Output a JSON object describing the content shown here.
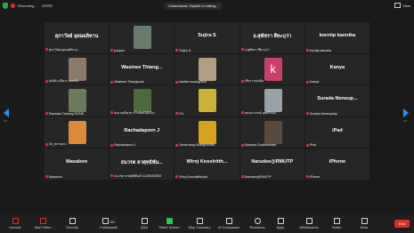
{
  "topbar": {
    "recording": "Recording...",
    "talking": "Chatchawan Silpakit is talking...",
    "view": "View"
  },
  "nav": {
    "left_page": "1/7",
    "right_page": "1/7"
  },
  "participants": [
    {
      "name": "สุภาวัลย์ อุดมผลิทาน",
      "label": "สุภาวัลย์ อุดมผลิทาน",
      "photo": false
    },
    {
      "name": "",
      "label": "jumpen",
      "photo": true,
      "photo_color": "#6a7c6f"
    },
    {
      "name": "Sujira S",
      "label": "Sujira S",
      "photo": false
    },
    {
      "name": "อ.สุพัชรา สี่ทะบุว่า",
      "label": "อ.สุพัชรา สี่ทะบุว่า",
      "photo": false
    },
    {
      "name": "korntip kannika",
      "label": "korntip kannika",
      "photo": false
    },
    {
      "name": "",
      "label": "A048 เปรียวา สมหวัง",
      "photo": true,
      "photo_color": "#8a7a6a"
    },
    {
      "name": "Wasinee  Thiang...",
      "label": "Wasinee Thiangsook",
      "photo": false
    },
    {
      "name": "",
      "label": "kanitar muangchoo",
      "photo": true,
      "photo_color": "#b0a080"
    },
    {
      "name": "",
      "label": "เกียรา ทองคิม",
      "photo": true,
      "photo_color": "#c9406a",
      "photo_letter": "k"
    },
    {
      "name": "Kanya",
      "label": "Kanya",
      "photo": false
    },
    {
      "name": "",
      "label": "Pancake Training RONE",
      "photo": true,
      "photo_color": "#6b7a5a"
    },
    {
      "name": "",
      "label": "พ.ต.กฤษิต ศาวโนรัตน์นิธีเรื่อง",
      "photo": true,
      "photo_color": "#4f6a3a"
    },
    {
      "name": "",
      "label": "Foi",
      "photo": true,
      "photo_color": "#c8b23a"
    },
    {
      "name": "",
      "label": "ลนนภาภรณ์ ลุยศรีลอน",
      "photo": true,
      "photo_color": "#9aa0a8"
    },
    {
      "name": "Surada  Nonsup...",
      "label": "Surada  Nonsuphap",
      "photo": false
    },
    {
      "name": "",
      "label": "03_ทรายเกว",
      "photo": true,
      "photo_color": "#d98a3a"
    },
    {
      "name": "Rachadaporn J",
      "label": "Rachadaporn J",
      "photo": false
    },
    {
      "name": "",
      "label": "Voravuang Duangchinda",
      "photo": true,
      "photo_color": "#d6a21f"
    },
    {
      "name": "",
      "label": "Surasak Chakhiandee",
      "photo": true,
      "photo_color": "#5a4a3e"
    },
    {
      "name": "iPad",
      "label": "iPad",
      "photo": false
    },
    {
      "name": "Masabon",
      "label": "Masabon",
      "photo": false
    },
    {
      "name": "ธนวรต ลาศุทธิพัน...",
      "label": "ธนวรต ลาศุทธิพันธ์ 01-5902/2563",
      "photo": false
    },
    {
      "name": "Wiroj  Kosolritth...",
      "label": "Wiroj Kosolritthichai",
      "photo": false
    },
    {
      "name": "Narudee@RMUTP",
      "label": "Narudee@RMUTP",
      "photo": false
    },
    {
      "name": "iPhone",
      "label": "iPhone",
      "photo": false
    }
  ],
  "toolbar": {
    "items": [
      {
        "label": "Unmute",
        "icon": "microphone-icon"
      },
      {
        "label": "Start Video",
        "icon": "video-camera-icon"
      },
      {
        "label": "Security",
        "icon": "shield-icon"
      },
      {
        "label": "Participants",
        "icon": "participants-icon",
        "count": "194"
      },
      {
        "label": "Q&A",
        "icon": "qa-icon"
      },
      {
        "label": "Share Screen",
        "icon": "share-screen-icon"
      },
      {
        "label": "Stop Summary",
        "icon": "summary-icon"
      },
      {
        "label": "AI Companion",
        "icon": "ai-companion-icon"
      },
      {
        "label": "Reactions",
        "icon": "reactions-icon"
      },
      {
        "label": "Apps",
        "icon": "apps-icon"
      },
      {
        "label": "Whiteboards",
        "icon": "whiteboard-icon"
      },
      {
        "label": "Notes",
        "icon": "notes-icon"
      },
      {
        "label": "More",
        "icon": "more-icon"
      }
    ],
    "end_label": "End"
  },
  "colors": {
    "accent": "#2f8cff",
    "share_green": "#2bc84f",
    "end_red": "#d93025",
    "mic_red": "#e0302f"
  }
}
